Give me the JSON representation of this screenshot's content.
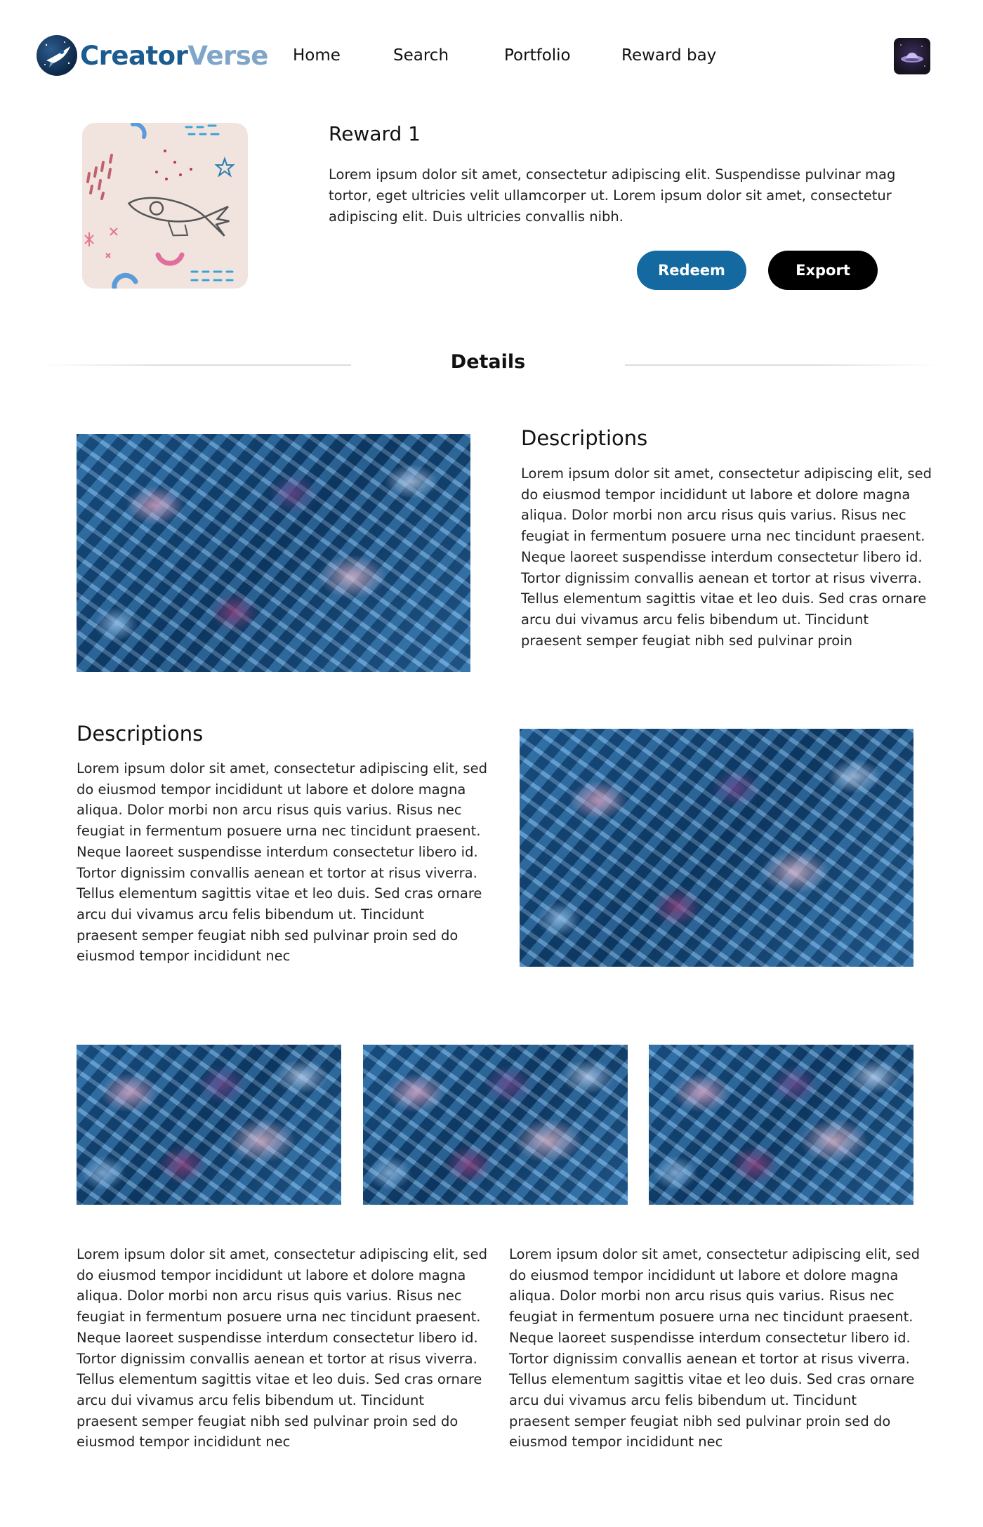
{
  "header": {
    "logo_part1": "Creator",
    "logo_part2": "Verse",
    "nav": [
      "Home",
      "Search",
      "Portfolio",
      "Reward bay"
    ]
  },
  "reward": {
    "title": "Reward 1",
    "description": "Lorem ipsum dolor sit amet, consectetur adipiscing elit. Suspendisse pulvinar mag tortor, eget ultricies velit ullamcorper ut. Lorem ipsum dolor sit amet, consectetur adipiscing elit. Duis ultricies convallis nibh.",
    "redeem_label": "Redeem",
    "export_label": "Export"
  },
  "details": {
    "title": "Details",
    "section1": {
      "heading": "Descriptions",
      "text": "Lorem ipsum dolor sit amet, consectetur adipiscing elit, sed do eiusmod tempor incididunt ut labore et dolore magna aliqua. Dolor morbi non arcu risus quis varius. Risus nec feugiat in fermentum posuere urna nec tincidunt praesent. Neque laoreet suspendisse interdum consectetur libero id. Tortor dignissim convallis aenean et tortor at risus viverra. Tellus elementum sagittis vitae et leo duis. Sed cras ornare arcu dui vivamus arcu felis bibendum ut. Tincidunt praesent semper feugiat nibh sed pulvinar proin"
    },
    "section2": {
      "heading": "Descriptions",
      "text": "Lorem ipsum dolor sit amet, consectetur adipiscing elit, sed do eiusmod tempor incididunt ut labore et dolore magna aliqua. Dolor morbi non arcu risus quis varius. Risus nec feugiat in fermentum posuere urna nec tincidunt praesent. Neque laoreet suspendisse interdum consectetur libero id. Tortor dignissim convallis aenean et tortor at risus viverra. Tellus elementum sagittis vitae et leo duis. Sed cras ornare arcu dui vivamus arcu felis bibendum ut. Tincidunt praesent semper feugiat nibh sed pulvinar proin sed do eiusmod tempor incididunt nec"
    },
    "bottom_left_text": "Lorem ipsum dolor sit amet, consectetur adipiscing elit, sed do eiusmod tempor incididunt ut labore et dolore magna aliqua. Dolor morbi non arcu risus quis varius. Risus nec feugiat in fermentum posuere urna nec tincidunt praesent. Neque laoreet suspendisse interdum consectetur libero id. Tortor dignissim convallis aenean et tortor at risus viverra. Tellus elementum sagittis vitae et leo duis. Sed cras ornare arcu dui vivamus arcu felis bibendum ut. Tincidunt praesent semper feugiat nibh sed pulvinar proin sed do eiusmod tempor incididunt nec",
    "bottom_right_text": "Lorem ipsum dolor sit amet, consectetur adipiscing elit, sed do eiusmod tempor incididunt ut labore et dolore magna aliqua. Dolor morbi non arcu risus quis varius. Risus nec feugiat in fermentum posuere urna nec tincidunt praesent. Neque laoreet suspendisse interdum consectetur libero id. Tortor dignissim convallis aenean et tortor at risus viverra. Tellus elementum sagittis vitae et leo duis. Sed cras ornare arcu dui vivamus arcu felis bibendum ut. Tincidunt praesent semper feugiat nibh sed pulvinar proin sed do eiusmod tempor incididunt nec"
  },
  "colors": {
    "brand_primary": "#1b5b8f",
    "brand_secondary": "#7fa6c8",
    "redeem_button": "#146aa0",
    "export_button": "#000000"
  },
  "icons": {
    "logo": "rocket-logo-icon",
    "avatar": "ufo-avatar-icon",
    "reward_thumbnail": "rocket-illustration-icon"
  }
}
